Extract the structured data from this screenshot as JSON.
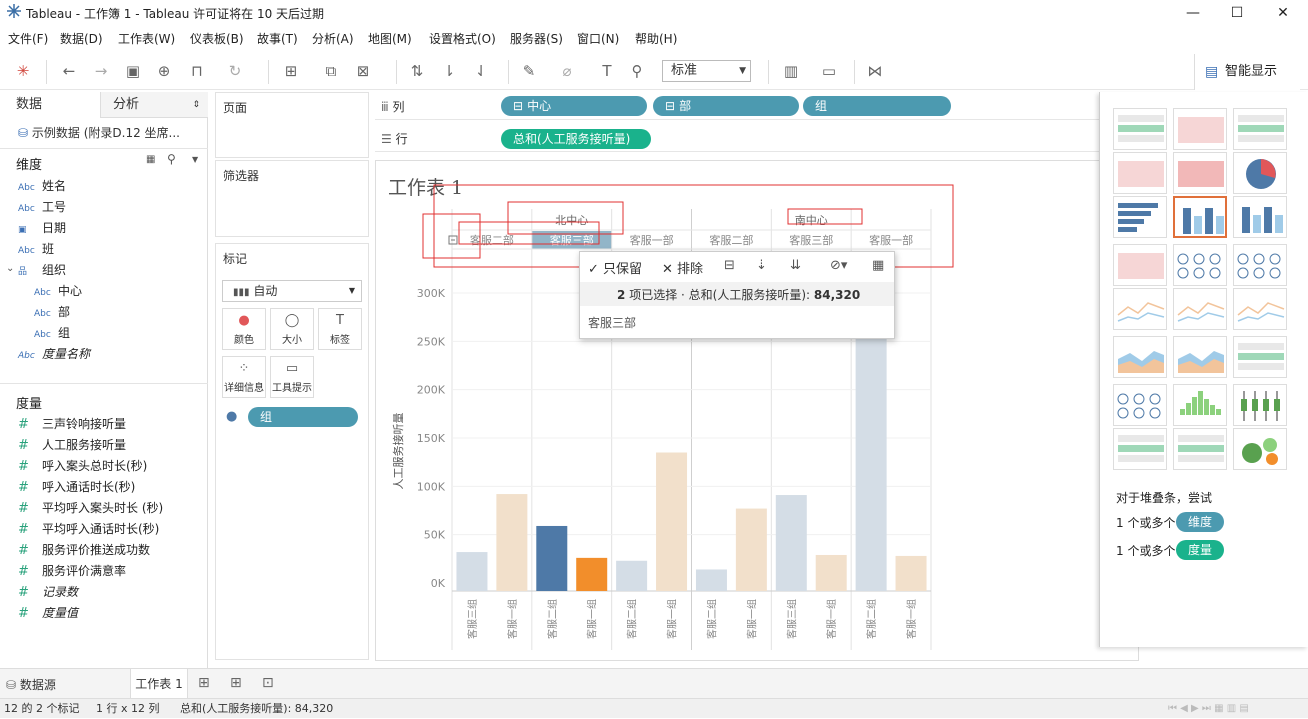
{
  "window": {
    "title": "Tableau - 工作簿 1 - Tableau 许可证将在 10 天后过期"
  },
  "menu": [
    "文件(F)",
    "数据(D)",
    "工作表(W)",
    "仪表板(B)",
    "故事(T)",
    "分析(A)",
    "地图(M)",
    "设置格式(O)",
    "服务器(S)",
    "窗口(N)",
    "帮助(H)"
  ],
  "toolbar": {
    "fit_value": "标准",
    "smart_label": "智能显示"
  },
  "left": {
    "tab_data": "数据",
    "tab_analysis": "分析",
    "datasource": "示例数据 (附录D.12 坐席...",
    "dimensions_header": "维度",
    "dimensions": [
      {
        "icon": "Abc",
        "label": "姓名"
      },
      {
        "icon": "Abc",
        "label": "工号"
      },
      {
        "icon": "date",
        "label": "日期"
      },
      {
        "icon": "Abc",
        "label": "班"
      },
      {
        "icon": "hier",
        "label": "组织"
      }
    ],
    "org_children": [
      {
        "icon": "Abc",
        "label": "中心"
      },
      {
        "icon": "Abc",
        "label": "部"
      },
      {
        "icon": "Abc",
        "label": "组"
      }
    ],
    "measure_names": "度量名称",
    "measures_header": "度量",
    "measures": [
      "三声铃响接听量",
      "人工服务接听量",
      "呼入案头总时长(秒)",
      "呼入通话时长(秒)",
      "平均呼入案头时长 (秒)",
      "平均呼入通话时长(秒)",
      "服务评价推送成功数",
      "服务评价满意率"
    ],
    "records": "记录数",
    "measure_values": "度量值"
  },
  "panels": {
    "pages": "页面",
    "filters": "筛选器",
    "marks": "标记",
    "mark_type": "自动",
    "mark_buttons": [
      "颜色",
      "大小",
      "标签",
      "详细信息",
      "工具提示"
    ],
    "color_pill": "组"
  },
  "shelves": {
    "columns_label": "列",
    "rows_label": "行",
    "columns": [
      "中心",
      "部",
      "组"
    ],
    "rows": [
      "总和(人工服务接听量)"
    ]
  },
  "view": {
    "title": "工作表 1"
  },
  "chart_data": {
    "type": "bar",
    "ylabel": "人工服务接听量",
    "ylim": [
      0,
      300000
    ],
    "ytick_labels": [
      "0K",
      "50K",
      "100K",
      "150K",
      "200K",
      "250K",
      "300K"
    ],
    "centers": [
      {
        "name": "北中心"
      },
      {
        "name": "南中心"
      }
    ],
    "departments": [
      "客服二部",
      "客服三部",
      "客服一部",
      "客服二部",
      "客服三部",
      "客服一部"
    ],
    "bars": [
      {
        "group": "客服三组",
        "value": 32000,
        "color": "#d4dde6"
      },
      {
        "group": "客服一组",
        "value": 92000,
        "color": "#f2e0cb"
      },
      {
        "group": "客服二组",
        "value": 59000,
        "color": "#4e79a7"
      },
      {
        "group": "客服一组",
        "value": 26000,
        "color": "#f28e2b"
      },
      {
        "group": "客服二组",
        "value": 23000,
        "color": "#d4dde6"
      },
      {
        "group": "客服一组",
        "value": 135000,
        "color": "#f2e0cb"
      },
      {
        "group": "客服二组",
        "value": 14000,
        "color": "#d4dde6"
      },
      {
        "group": "客服一组",
        "value": 77000,
        "color": "#f2e0cb"
      },
      {
        "group": "客服三组",
        "value": 91000,
        "color": "#d4dde6"
      },
      {
        "group": "客服一组",
        "value": 29000,
        "color": "#f2e0cb"
      },
      {
        "group": "客服二组",
        "value": 262000,
        "color": "#d4dde6"
      },
      {
        "group": "客服一组",
        "value": 28000,
        "color": "#f2e0cb"
      }
    ]
  },
  "tooltip": {
    "keep": "只保留",
    "exclude": "排除",
    "selected_count": "2",
    "summary_rest": "项已选择 · 总和(人工服务接听量):",
    "summary_value": "84,320",
    "item": "客服三部"
  },
  "smart": {
    "hint": "对于堆叠条，尝试",
    "req1_prefix": "1 个或多个",
    "req1_pill": "维度",
    "req2_prefix": "1 个或多个",
    "req2_pill": "度量"
  },
  "bottom": {
    "datasource_tab": "数据源",
    "sheet_tab": "工作表 1"
  },
  "status": {
    "marks": "12 的 2 个标记",
    "dims": "1 行 x 12 列",
    "sum": "总和(人工服务接听量): 84,320"
  },
  "colors": {
    "accent_teal": "#4c9ab0",
    "measure_green": "#1ab28c",
    "dim_pill": "#4c9ab0",
    "selected_thumb": "#e0703a"
  }
}
